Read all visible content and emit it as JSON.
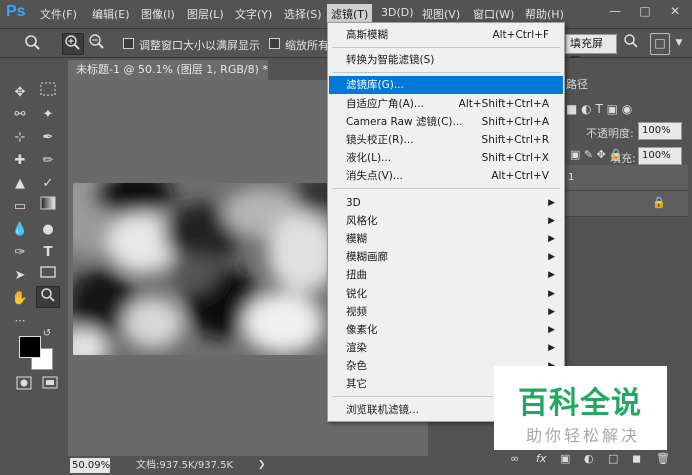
{
  "app": {
    "logo": "Ps",
    "menu": [
      "文件(F)",
      "编辑(E)",
      "图像(I)",
      "图层(L)",
      "文字(Y)",
      "选择(S)",
      "滤镜(T)",
      "3D(D)",
      "视图(V)",
      "窗口(W)",
      "帮助(H)"
    ],
    "active_menu": "滤镜(T)"
  },
  "options_bar": {
    "resize_label": "调整窗口大小以满屏显示",
    "zoom_all_label": "缩放所有",
    "fill_screen_label": "填充屏幕"
  },
  "document": {
    "tab_title": "未标题-1 @ 50.1% (图层 1, RGB/8) *",
    "zoom": "50.09%",
    "doc_info": "文档:937.5K/937.5K"
  },
  "panel": {
    "path_tab": "路径",
    "opacity_label": "不透明度:",
    "opacity_value": "100%",
    "fill_label": "填充:",
    "fill_value": "100%",
    "layer_name": "1"
  },
  "filter_menu": {
    "items": [
      {
        "label": "高斯模糊",
        "shortcut": "Alt+Ctrl+F"
      },
      {
        "label": "转换为智能滤镜(S)",
        "shortcut": ""
      },
      {
        "label": "滤镜库(G)...",
        "shortcut": "",
        "highlighted": true
      },
      {
        "label": "自适应广角(A)...",
        "shortcut": "Alt+Shift+Ctrl+A"
      },
      {
        "label": "Camera Raw 滤镜(C)...",
        "shortcut": "Shift+Ctrl+A"
      },
      {
        "label": "镜头校正(R)...",
        "shortcut": "Shift+Ctrl+R"
      },
      {
        "label": "液化(L)...",
        "shortcut": "Shift+Ctrl+X"
      },
      {
        "label": "消失点(V)...",
        "shortcut": "Alt+Ctrl+V"
      },
      {
        "label": "3D",
        "submenu": true
      },
      {
        "label": "风格化",
        "submenu": true
      },
      {
        "label": "模糊",
        "submenu": true
      },
      {
        "label": "模糊画廊",
        "submenu": true
      },
      {
        "label": "扭曲",
        "submenu": true
      },
      {
        "label": "锐化",
        "submenu": true
      },
      {
        "label": "视频",
        "submenu": true
      },
      {
        "label": "像素化",
        "submenu": true
      },
      {
        "label": "渲染",
        "submenu": true
      },
      {
        "label": "杂色",
        "submenu": true
      },
      {
        "label": "其它",
        "submenu": true
      },
      {
        "label": "浏览联机滤镜...",
        "shortcut": ""
      }
    ]
  },
  "watermark": {
    "title": "百科全说",
    "subtitle": "助你轻松解决"
  },
  "colors": {
    "accent": "#0078d7",
    "ps_blue": "#31a8ff",
    "watermark_green": "#22a862"
  }
}
